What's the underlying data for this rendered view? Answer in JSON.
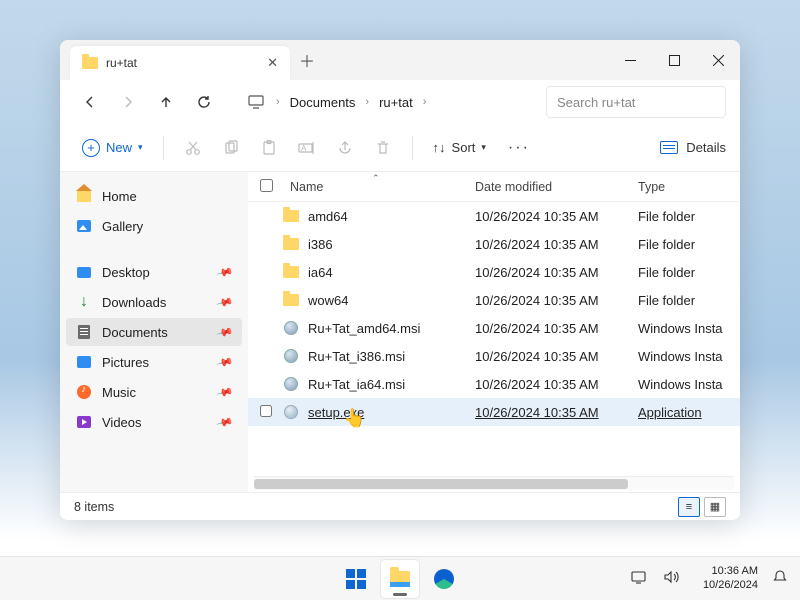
{
  "tab": {
    "title": "ru+tat"
  },
  "breadcrumb": {
    "seg1": "Documents",
    "seg2": "ru+tat"
  },
  "search": {
    "placeholder": "Search ru+tat"
  },
  "toolbar": {
    "new": "New",
    "sort": "Sort",
    "details": "Details"
  },
  "sidebar": {
    "home": "Home",
    "gallery": "Gallery",
    "desktop": "Desktop",
    "downloads": "Downloads",
    "documents": "Documents",
    "pictures": "Pictures",
    "music": "Music",
    "videos": "Videos"
  },
  "cols": {
    "name": "Name",
    "date": "Date modified",
    "type": "Type"
  },
  "rows": [
    {
      "name": "amd64",
      "date": "10/26/2024 10:35 AM",
      "type": "File folder",
      "kind": "folder"
    },
    {
      "name": "i386",
      "date": "10/26/2024 10:35 AM",
      "type": "File folder",
      "kind": "folder"
    },
    {
      "name": "ia64",
      "date": "10/26/2024 10:35 AM",
      "type": "File folder",
      "kind": "folder"
    },
    {
      "name": "wow64",
      "date": "10/26/2024 10:35 AM",
      "type": "File folder",
      "kind": "folder"
    },
    {
      "name": "Ru+Tat_amd64.msi",
      "date": "10/26/2024 10:35 AM",
      "type": "Windows Insta",
      "kind": "msi"
    },
    {
      "name": "Ru+Tat_i386.msi",
      "date": "10/26/2024 10:35 AM",
      "type": "Windows Insta",
      "kind": "msi"
    },
    {
      "name": "Ru+Tat_ia64.msi",
      "date": "10/26/2024 10:35 AM",
      "type": "Windows Insta",
      "kind": "msi"
    },
    {
      "name": "setup.exe",
      "date": "10/26/2024 10:35 AM",
      "type": "Application",
      "kind": "exe",
      "hover": true
    }
  ],
  "status": {
    "count": "8 items"
  },
  "tray": {
    "time": "10:36 AM",
    "date": "10/26/2024"
  }
}
